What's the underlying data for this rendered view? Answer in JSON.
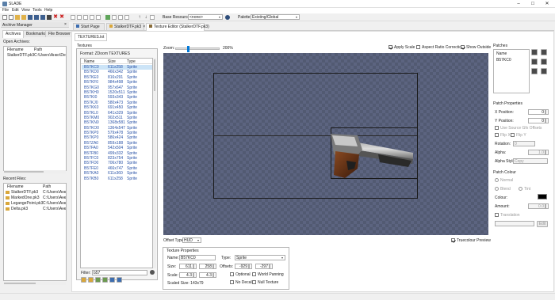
{
  "app": {
    "title": "SLADE"
  },
  "menubar": {
    "items": [
      "File",
      "Edit",
      "View",
      "Tools",
      "Help"
    ]
  },
  "toolbar": {
    "base_resource_label": "Base Resource:",
    "base_resource_value": "<none>",
    "palette_label": "Palette:",
    "palette_value": "Existing/Global"
  },
  "archive_manager": {
    "title": "Archive Manager",
    "tabs": [
      "Archives",
      "Bookmarks",
      "File Browser"
    ],
    "open_archives_label": "Open Archives:",
    "columns": [
      "Filename",
      "Path"
    ],
    "open_archives": [
      {
        "name": "StalkerDTF.pk3",
        "path": "C:\\Users\\Анко\\Desktop\\"
      }
    ],
    "recent_label": "Recent Files:",
    "recent_columns": [
      "Filename",
      "Path"
    ],
    "recent": [
      {
        "name": "StalkerDTF.pk3",
        "path": "C:\\Users\\Анко\\"
      },
      {
        "name": "MarkedOne.pk3",
        "path": "C:\\Users\\Анко\\"
      },
      {
        "name": "LegangePoint.pk3",
        "path": "C:\\Users\\Анко\\"
      },
      {
        "name": "Delta.pk3",
        "path": "C:\\Users\\Анко\\"
      }
    ]
  },
  "doc_tabs": [
    "Start Page",
    "StalkerDTF.pk3",
    "Texture Editor (StalkerDTF.pk3)"
  ],
  "sub_tab": "TEXTURES.txt",
  "textures": {
    "label": "Textures",
    "format": "Format: ZDoom TEXTURES",
    "columns": [
      "Name",
      "Size",
      "Type"
    ],
    "rows": [
      [
        "B57KC0",
        "611x258",
        "Sprite"
      ],
      [
        "B57KD0",
        "466x342",
        "Sprite"
      ],
      [
        "B57KE0",
        "816x291",
        "Sprite"
      ],
      [
        "B57KF0",
        "984x498",
        "Sprite"
      ],
      [
        "B57KG0",
        "957x647",
        "Sprite"
      ],
      [
        "B57KH0",
        "1520x511",
        "Sprite"
      ],
      [
        "B57KI0",
        "593x343",
        "Sprite"
      ],
      [
        "B57KJ0",
        "580x473",
        "Sprite"
      ],
      [
        "B57KK0",
        "691x450",
        "Sprite"
      ],
      [
        "B57KL0",
        "641x329",
        "Sprite"
      ],
      [
        "B57KM0",
        "902x511",
        "Sprite"
      ],
      [
        "B57KN0",
        "1368x581",
        "Sprite"
      ],
      [
        "B57KO0",
        "1364x547",
        "Sprite"
      ],
      [
        "B57KP0",
        "579x478",
        "Sprite"
      ],
      [
        "B57KP0",
        "586x424",
        "Sprite"
      ],
      [
        "B57ZA0",
        "859x188",
        "Sprite"
      ],
      [
        "B57FA0",
        "542x504",
        "Sprite"
      ],
      [
        "B57FB0",
        "499x332",
        "Sprite"
      ],
      [
        "B57FC0",
        "823x754",
        "Sprite"
      ],
      [
        "B57FD0",
        "706x780",
        "Sprite"
      ],
      [
        "B57FE0",
        "466x747",
        "Sprite"
      ],
      [
        "B57KA0",
        "611x360",
        "Sprite"
      ],
      [
        "B57KB0",
        "611x258",
        "Sprite"
      ]
    ],
    "filter_label": "Filter:",
    "filter_value": "b57"
  },
  "canvas": {
    "zoom_label": "Zoom:",
    "zoom_value": "200%",
    "zoom_fraction": 0.25,
    "apply_scale": "Apply Scale",
    "aspect": "Aspect Ratio Correction",
    "show_outside": "Show Outside",
    "offset_type_label": "Offset Type:",
    "offset_type_value": "HUD",
    "truecolour": "Truecolour Preview"
  },
  "texture_props": {
    "title": "Texture Properties",
    "name_label": "Name:",
    "name_value": "B57KC0",
    "type_label": "Type:",
    "type_value": "Sprite",
    "size_label": "Size:",
    "size_w": "611",
    "size_h": "258",
    "offsets_label": "Offsets:",
    "off_x": "-929",
    "off_y": "-297",
    "scale_label": "Scale:",
    "scale_x": "4.3",
    "scale_y": "4.3",
    "scaled_size": "Scaled Size: 143x79",
    "optional": "Optional",
    "world_panning": "World Panning",
    "no_decals": "No Decals",
    "null_texture": "Null Texture"
  },
  "patches": {
    "title": "Patches",
    "name_col": "Name",
    "items": [
      "B57KC0"
    ],
    "props_title": "Patch Properties",
    "x_label": "X Position:",
    "x_value": "0",
    "y_label": "Y Position:",
    "y_value": "0",
    "use_source": "Use Source Gfx Offsets",
    "flip_x": "Flip X",
    "flip_y": "Flip Y",
    "rotation_label": "Rotation:",
    "rotation_value": "0",
    "alpha_label": "Alpha:",
    "alpha_value": "1.0",
    "alpha_style_label": "Alpha Style:",
    "alpha_style_value": "Copy",
    "colour_title": "Patch Colour",
    "normal": "Normal",
    "blend": "Blend",
    "tint": "Tint",
    "colour_label": "Colour:",
    "amount_label": "Amount:",
    "amount_value": "0.0",
    "translation": "Translation",
    "edit": "Edit"
  }
}
